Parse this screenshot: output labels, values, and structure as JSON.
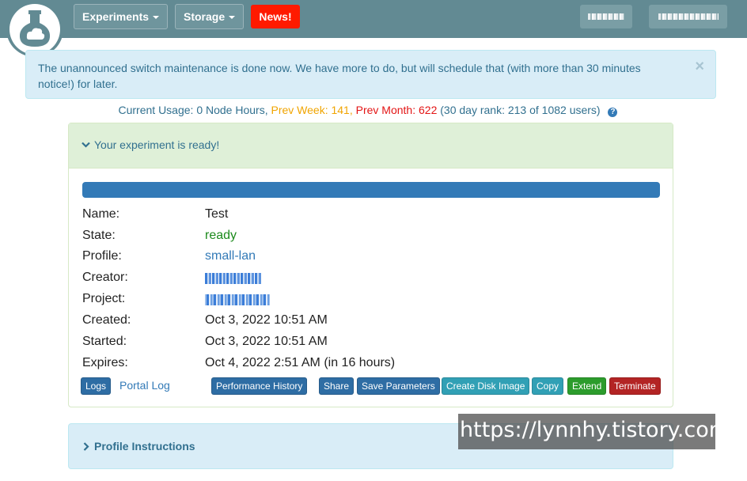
{
  "navbar": {
    "experiments_label": "Experiments",
    "storage_label": "Storage",
    "news_label": "News!",
    "brand_color": "#628a93",
    "news_color": "#ff1a00"
  },
  "alert": {
    "text": "The unannounced switch maintenance is done now. We have more to do, but will schedule that (with more than 30 minutes notice!) for later.",
    "close_label": "×"
  },
  "usage": {
    "current": "Current Usage: 0 Node Hours,",
    "prev_week": "Prev Week: 141,",
    "prev_month": "Prev Month: 622",
    "rank": "(30 day rank: 213 of 1082 users)",
    "help_icon": "?"
  },
  "experiment": {
    "heading": "Your experiment is ready!",
    "progress": 1.0,
    "fields": [
      {
        "label": "Name:",
        "value": "Test"
      },
      {
        "label": "State:",
        "value": "ready"
      },
      {
        "label": "Profile:",
        "value": "small-lan"
      },
      {
        "label": "Creator:",
        "value": ""
      },
      {
        "label": "Project:",
        "value": ""
      },
      {
        "label": "Created:",
        "value": "Oct 3, 2022 10:51 AM"
      },
      {
        "label": "Started:",
        "value": "Oct 3, 2022 10:51 AM"
      },
      {
        "label": "Expires:",
        "value": "Oct 4, 2022 2:51 AM (in 16 hours)"
      }
    ],
    "buttons": {
      "logs": "Logs",
      "portal_log": "Portal Log",
      "performance_history": "Performance History",
      "share": "Share",
      "save_parameters": "Save Parameters",
      "create_disk_image": "Create Disk Image",
      "copy": "Copy",
      "extend": "Extend",
      "terminate": "Terminate"
    }
  },
  "profile_instructions": {
    "heading": "Profile Instructions"
  },
  "watermark": {
    "text": "https://lynnhy.tistory.com"
  }
}
